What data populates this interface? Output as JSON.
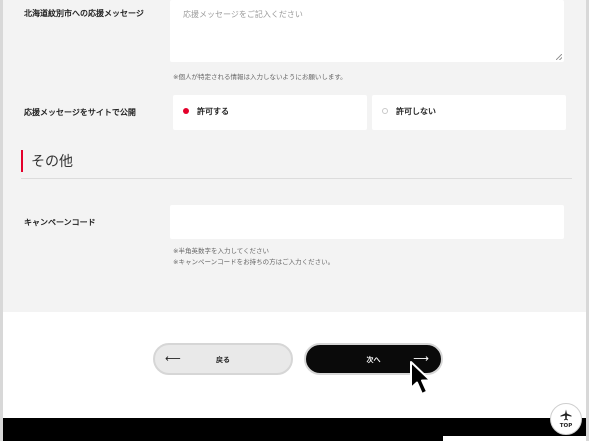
{
  "form": {
    "message": {
      "label": "北海道紋別市への応援メッセージ",
      "placeholder": "応援メッセージをご記入ください",
      "note": "※個人が特定される情報は入力しないようにお願いします。"
    },
    "publish": {
      "label": "応援メッセージをサイトで公開",
      "options": [
        {
          "label": "許可する",
          "selected": true
        },
        {
          "label": "許可しない",
          "selected": false
        }
      ]
    }
  },
  "section_other": {
    "title": "その他"
  },
  "campaign": {
    "label": "キャンペーンコード",
    "value": "",
    "notes": [
      "※半角英数字を入力してください",
      "※キャンペーンコードをお持ちの方はご入力ください。"
    ]
  },
  "nav": {
    "back_label": "戻る",
    "back_arrow": "⟵",
    "next_label": "次へ",
    "next_arrow": "⟶"
  },
  "top_button": {
    "label": "TOP",
    "icon": "airplane-icon"
  },
  "colors": {
    "accent": "#e4002b",
    "form_bg": "#f3f3f3",
    "next_button": "#0a0a0a",
    "footer": "#000000"
  }
}
